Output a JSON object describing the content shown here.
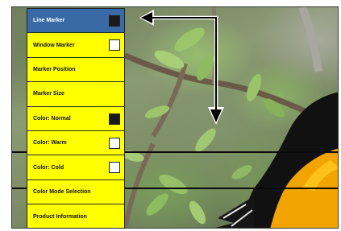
{
  "colors": {
    "menu_bg": "#ffff00",
    "selected_bg": "#3a6aa6",
    "checked_box": "#1a1a1a",
    "unchecked_box": "#ffffff",
    "marker_line": "#0a0a0a"
  },
  "menu": {
    "items": [
      {
        "label": "Line Marker",
        "checkbox": true,
        "checked": true,
        "selected": true
      },
      {
        "label": "Window Marker",
        "checkbox": true,
        "checked": false,
        "selected": false
      },
      {
        "label": "Marker Position",
        "checkbox": false,
        "checked": false,
        "selected": false
      },
      {
        "label": "Marker Size",
        "checkbox": false,
        "checked": false,
        "selected": false
      },
      {
        "label": "Color: Normal",
        "checkbox": true,
        "checked": true,
        "selected": false
      },
      {
        "label": "Color: Warm",
        "checkbox": true,
        "checked": false,
        "selected": false
      },
      {
        "label": "Color: Cold",
        "checkbox": true,
        "checked": false,
        "selected": false
      },
      {
        "label": "Color Mode Selection",
        "checkbox": false,
        "checked": false,
        "selected": false
      },
      {
        "label": "Product Information",
        "checkbox": false,
        "checked": false,
        "selected": false
      }
    ]
  },
  "overlay": {
    "marker_lines": 2,
    "arrow_icon": "elbow-arrow-icon"
  }
}
